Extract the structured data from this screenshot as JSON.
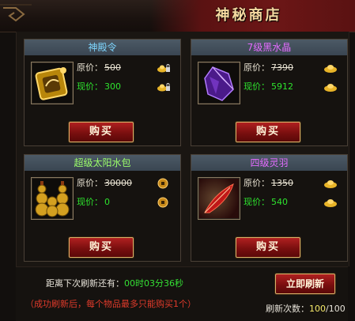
{
  "window": {
    "title": "神秘商店"
  },
  "items": [
    {
      "name": "神殿令",
      "name_color": "#7ed6ff",
      "old_label": "原价：",
      "old_price": "500",
      "new_label": "现价：",
      "new_price": "300",
      "currency_icon": "gold-ingot-lock-icon",
      "buy_label": "购买",
      "item_icon": "golden-token-icon"
    },
    {
      "name": "7级黑水晶",
      "name_color": "#e46bff",
      "old_label": "原价：",
      "old_price": "7390",
      "new_label": "现价：",
      "new_price": "5912",
      "currency_icon": "gold-ingot-icon",
      "buy_label": "购买",
      "item_icon": "purple-crystal-icon"
    },
    {
      "name": "超级太阳水包",
      "name_color": "#9cff6a",
      "old_label": "原价：",
      "old_price": "30000",
      "new_label": "现价：",
      "new_price": "0",
      "currency_icon": "copper-coin-icon",
      "buy_label": "购买",
      "item_icon": "gourd-bundle-icon"
    },
    {
      "name": "四级灵羽",
      "name_color": "#e46bff",
      "old_label": "原价：",
      "old_price": "1350",
      "new_label": "现价：",
      "new_price": "540",
      "currency_icon": "gold-ingot-icon",
      "buy_label": "购买",
      "item_icon": "red-feather-icon"
    }
  ],
  "footer": {
    "refresh_prefix": "距离下次刷新还有：",
    "refresh_time": "00时03分36秒",
    "warning": "（成功刷新后，每个物品最多只能购买1个）",
    "refresh_button": "立即刷新",
    "count_label": "刷新次数：",
    "count_current": "100",
    "count_total": "/100"
  },
  "colors": {
    "accent": "#d9b36a",
    "button": "#8a1414",
    "green": "#2ee32e",
    "red": "#e23b2b"
  }
}
